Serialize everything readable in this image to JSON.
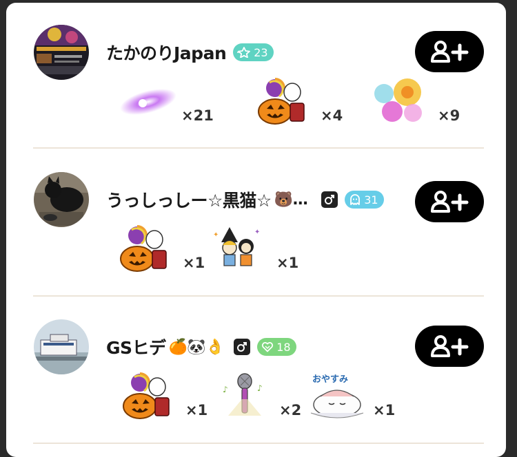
{
  "users": [
    {
      "name": "たかのりJapan",
      "name_suffix": "",
      "gender_icon": false,
      "badge": {
        "value": "23",
        "color": "#5fd3c2",
        "icon": "star-badge-icon"
      },
      "follow_icon": "add-user-icon",
      "gifts": [
        {
          "icon": "purple-comet-gift-icon",
          "count": "×21"
        },
        {
          "icon": "jack-o-lantern-gift-icon",
          "count": "×4"
        },
        {
          "icon": "fireworks-gift-icon",
          "count": "×9"
        }
      ]
    },
    {
      "name": "うっしっしー☆黒猫☆",
      "name_suffix": "🐻…",
      "gender_icon": true,
      "badge": {
        "value": "31",
        "color": "#66cde8",
        "icon": "ghost-badge-icon"
      },
      "follow_icon": "add-user-icon",
      "gifts": [
        {
          "icon": "jack-o-lantern-gift-icon",
          "count": "×1"
        },
        {
          "icon": "witch-duo-gift-icon",
          "count": "×1"
        }
      ]
    },
    {
      "name": "GSヒデ",
      "name_suffix": "🍊🐼👌",
      "gender_icon": true,
      "badge": {
        "value": "18",
        "color": "#7ed67e",
        "icon": "heart-badge-icon"
      },
      "follow_icon": "add-user-icon",
      "gifts": [
        {
          "icon": "jack-o-lantern-gift-icon",
          "count": "×1"
        },
        {
          "icon": "microphone-gift-icon",
          "count": "×2"
        },
        {
          "icon": "oyasumi-sheep-gift-icon",
          "count": "×1",
          "caption": "おやすみ"
        }
      ]
    }
  ]
}
